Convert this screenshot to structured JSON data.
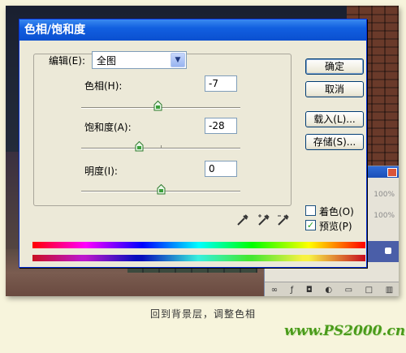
{
  "dialog": {
    "title": "色相/饱和度",
    "edit_label": "编辑(E):",
    "edit_value": "全图",
    "hue": {
      "label": "色相(H):",
      "value": "-7",
      "level": -7
    },
    "saturation": {
      "label": "饱和度(A):",
      "value": "-28",
      "level": -28
    },
    "lightness": {
      "label": "明度(I):",
      "value": "0",
      "level": 0
    },
    "buttons": {
      "ok": "确定",
      "cancel": "取消",
      "load": "载入(L)...",
      "save": "存储(S)..."
    },
    "colorize": {
      "label": "着色(O)",
      "checked": false
    },
    "preview": {
      "label": "预览(P)",
      "checked": true
    }
  },
  "layers_panel": {
    "opacity_1": "100%",
    "opacity_2": "100%"
  },
  "caption": "回到背景层，调整色相",
  "watermark": "www.PS2000.cn"
}
